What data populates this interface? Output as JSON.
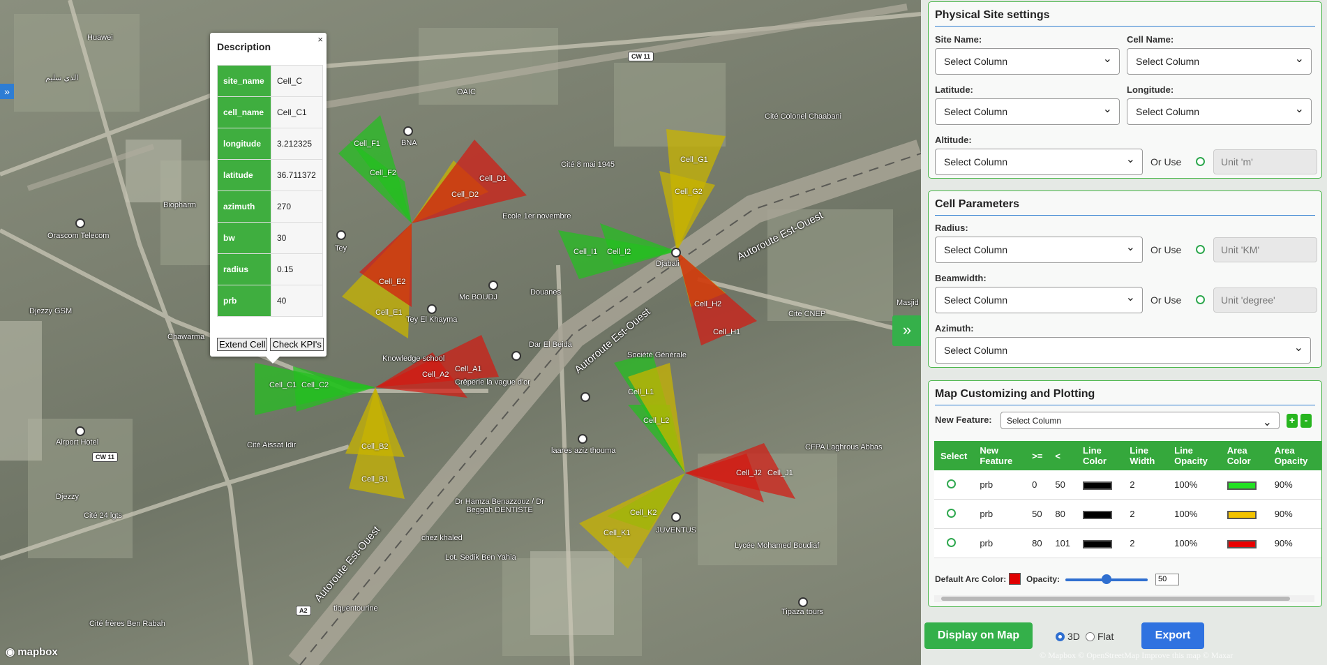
{
  "map": {
    "places": [
      "Huawei",
      "الذي سليم",
      "Orascom Telecom",
      "Biopharm",
      "Djezzy GSM",
      "Chawarma",
      "Airport Hotel",
      "Djezzy",
      "Cité 24 lgts",
      "Cité frères Ben Rabah",
      "tiquentourine",
      "Cité Aissat Idir",
      "OAIC",
      "BNA",
      "Cité 8 mai 1945",
      "Ecole 1er novembre",
      "Douanes",
      "Mc BOUDJ",
      "Tey El Khayma",
      "Knowledge school",
      "Crêperie la vague d'or",
      "Dar El Beida",
      "Société Générale",
      "laares aziz thouma",
      "chez khaled",
      "Lot. Sedik Ben Yahia",
      "Dr Hamza Benazzouz / Dr Beggah DENTISTE",
      "JUVENTUS",
      "Djabali",
      "Cité Colonel Chaabani",
      "Cité CNEP",
      "CFPA Laghrous Abbas",
      "Lycée Mohamed Boudiaf",
      "Tipaza tours",
      "Tey",
      "Masjid"
    ],
    "roads": [
      "Autoroute Est-Ouest",
      "Autoroute Est-Ouest",
      "Autoroute Est-Ouest"
    ],
    "shields": [
      "CW 11",
      "CW 11",
      "A2"
    ],
    "cells": [
      "Cell_F1",
      "Cell_F2",
      "Cell_D1",
      "Cell_D2",
      "Cell_G1",
      "Cell_G2",
      "Cell_I1",
      "Cell_I2",
      "Cell_E2",
      "Cell_E1",
      "Cell_H2",
      "Cell_H1",
      "Cell_A1",
      "Cell_A2",
      "Cell_C1",
      "Cell_C2",
      "Cell_L1",
      "Cell_L2",
      "Cell_B2",
      "Cell_B1",
      "Cell_J2",
      "Cell_J1",
      "Cell_K2",
      "Cell_K1"
    ],
    "logo": "mapbox",
    "attribution": "© Mapbox © OpenStreetMap Improve this map © Maxar"
  },
  "popup": {
    "title": "Description",
    "close": "×",
    "rows": [
      {
        "key": "site_name",
        "value": "Cell_C"
      },
      {
        "key": "cell_name",
        "value": "Cell_C1"
      },
      {
        "key": "longitude",
        "value": "3.212325"
      },
      {
        "key": "latitude",
        "value": "36.711372"
      },
      {
        "key": "azimuth",
        "value": "270"
      },
      {
        "key": "bw",
        "value": "30"
      },
      {
        "key": "radius",
        "value": "0.15"
      },
      {
        "key": "prb",
        "value": "40"
      }
    ],
    "extend_btn": "Extend Cell",
    "kpi_btn": "Check KPI's"
  },
  "panel": {
    "physical": {
      "title": "Physical Site settings",
      "site_name_label": "Site Name:",
      "cell_name_label": "Cell Name:",
      "latitude_label": "Latitude:",
      "longitude_label": "Longitude:",
      "altitude_label": "Altitude:",
      "select": "Select Column",
      "or_use": "Or Use",
      "altitude_unit": "Unit 'm'"
    },
    "cell": {
      "title": "Cell Parameters",
      "radius_label": "Radius:",
      "beamwidth_label": "Beamwidth:",
      "azimuth_label": "Azimuth:",
      "select": "Select Column",
      "or_use": "Or Use",
      "radius_unit": "Unit 'KM'",
      "bw_unit": "Unit 'degree'"
    },
    "custom": {
      "title": "Map Customizing and Plotting",
      "new_feature_label": "New Feature:",
      "select": "Select Column",
      "plus": "+",
      "minus": "-",
      "headers": [
        "Select",
        "New Feature",
        ">=",
        "<",
        "Line Color",
        "Line Width",
        "Line Opacity",
        "Area Color",
        "Area Opacity"
      ],
      "rows": [
        {
          "feature": "prb",
          "ge": "0",
          "lt": "50",
          "line_color": "#000000",
          "line_width": "2",
          "line_opacity": "100%",
          "area_color": "#22e022",
          "area_opacity": "90%"
        },
        {
          "feature": "prb",
          "ge": "50",
          "lt": "80",
          "line_color": "#000000",
          "line_width": "2",
          "line_opacity": "100%",
          "area_color": "#f2c200",
          "area_opacity": "90%"
        },
        {
          "feature": "prb",
          "ge": "80",
          "lt": "101",
          "line_color": "#000000",
          "line_width": "2",
          "line_opacity": "100%",
          "area_color": "#e80000",
          "area_opacity": "90%"
        }
      ],
      "default_arc_label": "Default Arc Color:",
      "default_arc_color": "#e00000",
      "opacity_label": "Opacity:",
      "opacity_value": "50"
    },
    "display_btn": "Display on Map",
    "mode_3d": "3D",
    "mode_flat": "Flat",
    "export_btn": "Export"
  }
}
